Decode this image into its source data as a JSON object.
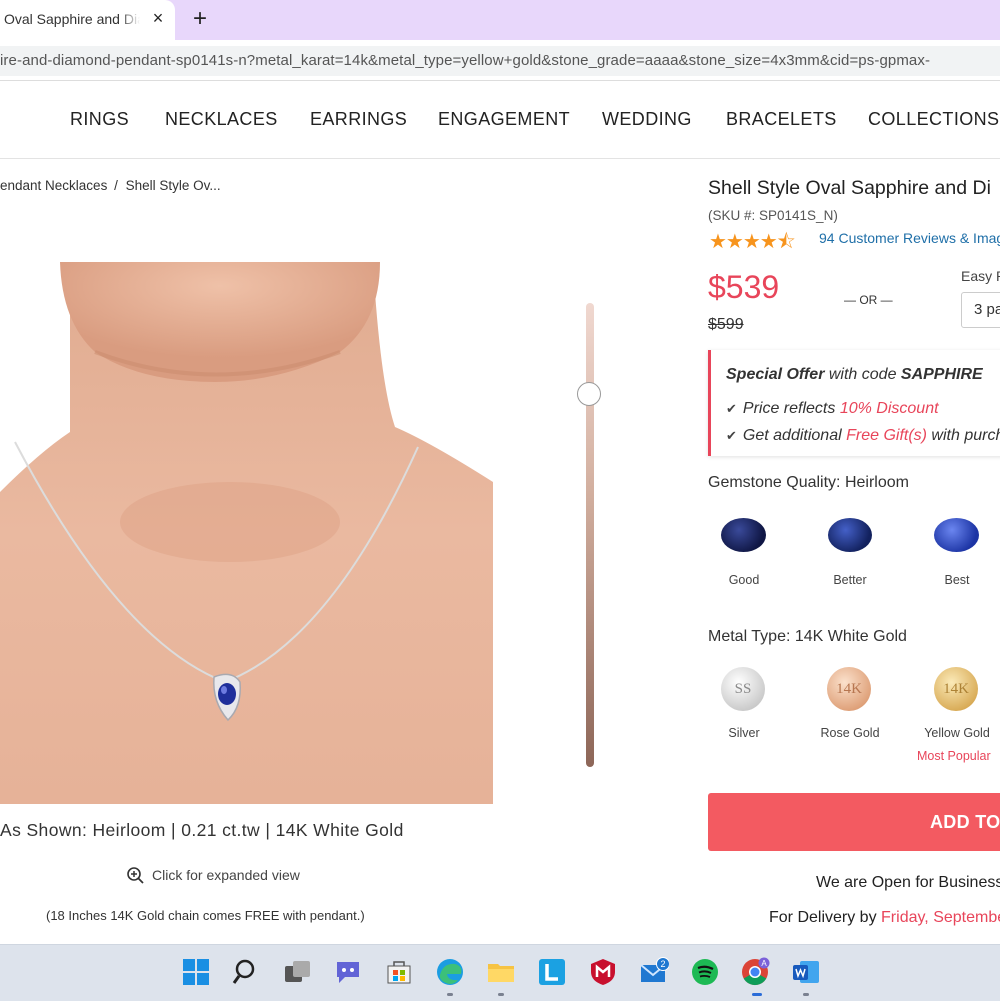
{
  "browser": {
    "tab_title": "Oval Sapphire and Diamond",
    "tab_close": "×",
    "new_tab": "+",
    "url": "ire-and-diamond-pendant-sp0141s-n?metal_karat=14k&metal_type=yellow+gold&stone_grade=aaaa&stone_size=4x3mm&cid=ps-gpmax-"
  },
  "nav": {
    "items": [
      "RINGS",
      "NECKLACES",
      "EARRINGS",
      "ENGAGEMENT",
      "WEDDING",
      "BRACELETS",
      "COLLECTIONS"
    ]
  },
  "breadcrumb": {
    "parent": "endant Necklaces",
    "separator": "/",
    "current": "Shell Style Ov..."
  },
  "gallery": {
    "zoom_level": 0.18,
    "shown_caption": "As Shown: Heirloom | 0.21 ct.tw | 14K White Gold",
    "expand_label": "Click for expanded view",
    "chain_note": "(18 Inches 14K Gold chain comes FREE with pendant.)"
  },
  "product": {
    "title": "Shell Style Oval Sapphire and Di",
    "sku": "(SKU #: SP0141S_N)",
    "rating": 4.5,
    "stars": "★★★★⯪",
    "reviews_label": "94 Customer Reviews & Imag",
    "price": "$539",
    "old_price": "$599",
    "or_separator": "— OR —",
    "easy_pay_label": "Easy P",
    "easy_pay_value": "3 pa"
  },
  "offer": {
    "title_italic": "Special Offer",
    "title_mid": " with code ",
    "code": "SAPPHIRE",
    "line1_prefix": "Price reflects ",
    "line1_highlight": "10% Discount",
    "line2_prefix": "Get additional ",
    "line2_highlight": "Free Gift(s)",
    "line2_suffix": " with purch",
    "check": "✔"
  },
  "gemstone": {
    "heading": "Gemstone Quality: Heirloom",
    "options": [
      {
        "label": "Good",
        "color": "#1b2660"
      },
      {
        "label": "Better",
        "color": "#1d3484"
      },
      {
        "label": "Best",
        "color": "#2647b8"
      }
    ]
  },
  "metal": {
    "heading": "Metal Type: 14K White Gold",
    "options": [
      {
        "label": "Silver",
        "badge": "SS",
        "color": "#d9d9d9"
      },
      {
        "label": "Rose Gold",
        "badge": "14K",
        "color": "#e9b48f"
      },
      {
        "label": "Yellow Gold",
        "badge": "14K",
        "color": "#e6c173"
      }
    ],
    "most_popular": "Most Popular"
  },
  "cart": {
    "add_label": "ADD TO",
    "open_note": "We are Open for Business",
    "delivery_prefix": "For Delivery by ",
    "delivery_date": "Friday, Septembe"
  },
  "taskbar": {
    "notification_badge": "2",
    "chrome_badge": "A",
    "icons": [
      "windows-start-icon",
      "search-icon",
      "task-view-icon",
      "teams-chat-icon",
      "microsoft-store-icon",
      "edge-browser-icon",
      "file-explorer-icon",
      "l-app-icon",
      "mcafee-icon",
      "mail-icon",
      "spotify-icon",
      "chrome-icon",
      "word-icon"
    ]
  },
  "colors": {
    "accent_red": "#e8455a",
    "button_red": "#f35a61",
    "star_orange": "#f7941d",
    "link_blue": "#1f6fa8",
    "tabbar_purple": "#e8d7fb"
  }
}
